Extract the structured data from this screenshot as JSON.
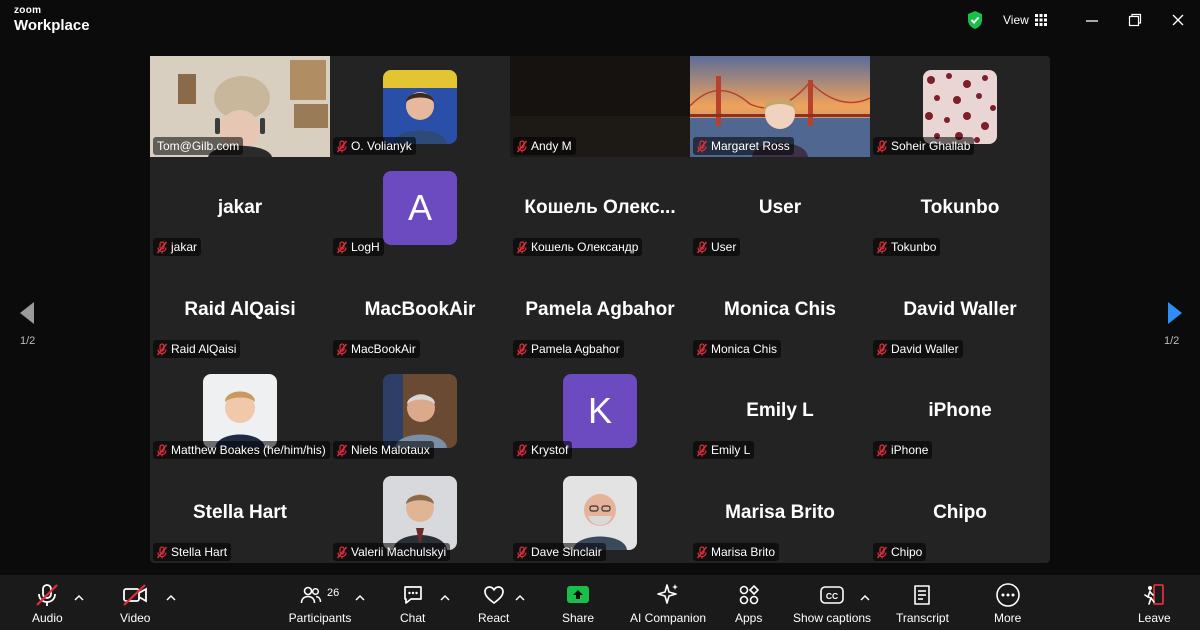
{
  "app": {
    "brand_top": "zoom",
    "brand_bottom": "Workplace"
  },
  "topbar": {
    "view_label": "View"
  },
  "gallery": {
    "participants": [
      {
        "display": "",
        "label": "Tom@Gilb.com",
        "type": "video",
        "muted": false
      },
      {
        "display": "",
        "label": "O. Volianyk",
        "type": "avatar-photo",
        "muted": true
      },
      {
        "display": "",
        "label": "Andy M",
        "type": "video-dark",
        "muted": true
      },
      {
        "display": "",
        "label": "Margaret Ross",
        "type": "video-bridge",
        "muted": true
      },
      {
        "display": "",
        "label": "Soheir Ghallab",
        "type": "avatar-pattern",
        "muted": true
      },
      {
        "display": "jakar",
        "label": "jakar",
        "type": "name",
        "muted": true
      },
      {
        "display": "A",
        "label": "LogH",
        "type": "avatar-letter",
        "muted": true
      },
      {
        "display": "Кошель  Олекс...",
        "label": "Кошель Олександр",
        "type": "name",
        "muted": true
      },
      {
        "display": "User",
        "label": "User",
        "type": "name",
        "muted": true
      },
      {
        "display": "Tokunbo",
        "label": "Tokunbo",
        "type": "name",
        "muted": true
      },
      {
        "display": "Raid AlQaisi",
        "label": "Raid AlQaisi",
        "type": "name",
        "muted": true
      },
      {
        "display": "MacBookAir",
        "label": "MacBookAir",
        "type": "name",
        "muted": true
      },
      {
        "display": "Pamela Agbahor",
        "label": "Pamela Agbahor",
        "type": "name",
        "muted": true
      },
      {
        "display": "Monica Chis",
        "label": "Monica Chis",
        "type": "name",
        "muted": true
      },
      {
        "display": "David Waller",
        "label": "David Waller",
        "type": "name",
        "muted": true
      },
      {
        "display": "",
        "label": "Matthew Boakes (he/him/his)",
        "type": "avatar-photo",
        "muted": true
      },
      {
        "display": "",
        "label": "Niels Malotaux",
        "type": "avatar-photo",
        "muted": true
      },
      {
        "display": "K",
        "label": "Krystof",
        "type": "avatar-letter",
        "muted": true
      },
      {
        "display": "Emily L",
        "label": "Emily L",
        "type": "name",
        "muted": true
      },
      {
        "display": "iPhone",
        "label": "iPhone",
        "type": "name",
        "muted": true
      },
      {
        "display": "Stella Hart",
        "label": "Stella Hart",
        "type": "name",
        "muted": true
      },
      {
        "display": "",
        "label": "Valerii Machulskyi",
        "type": "avatar-photo",
        "muted": true
      },
      {
        "display": "",
        "label": "Dave Sinclair",
        "type": "avatar-photo",
        "muted": true
      },
      {
        "display": "Marisa Brito",
        "label": "Marisa Brito",
        "type": "name",
        "muted": true
      },
      {
        "display": "Chipo",
        "label": "Chipo",
        "type": "name",
        "muted": true
      }
    ]
  },
  "pagination": {
    "left": "1/2",
    "right": "1/2"
  },
  "toolbar": {
    "audio": "Audio",
    "video": "Video",
    "participants": "Participants",
    "participants_count": "26",
    "chat": "Chat",
    "react": "React",
    "share": "Share",
    "ai_companion": "AI Companion",
    "apps": "Apps",
    "captions": "Show captions",
    "transcript": "Transcript",
    "more": "More",
    "leave": "Leave"
  },
  "colors": {
    "accent": "#3b82f6",
    "share_green": "#18c04a",
    "mute_red": "#e02d3c",
    "active_border": "#3bd37e",
    "letter_avatar": "#6c4bc1"
  }
}
